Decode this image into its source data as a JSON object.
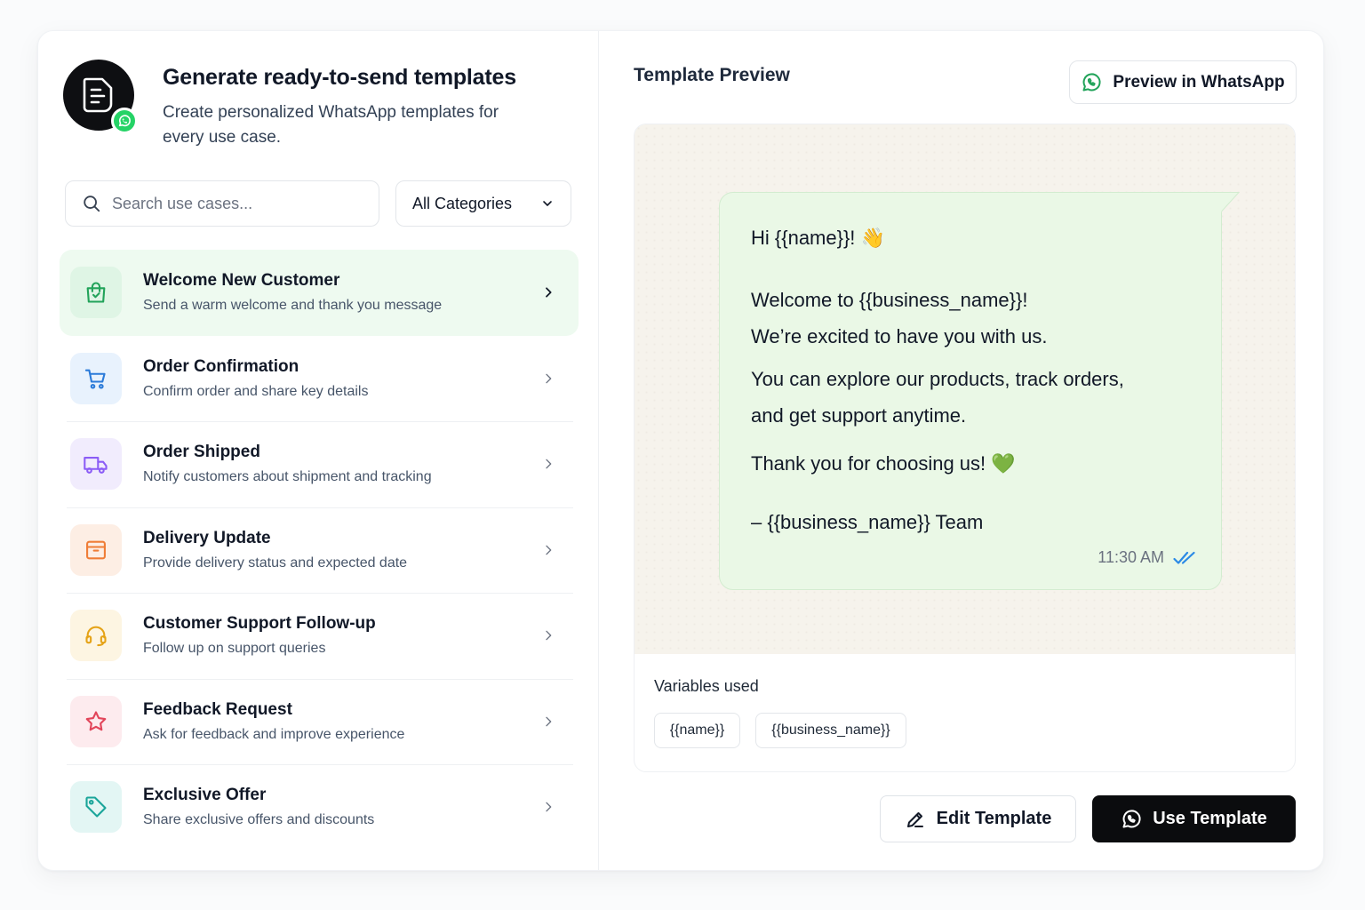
{
  "header": {
    "title": "Generate ready-to-send templates",
    "subtitle": "Create personalized WhatsApp templates for every use case."
  },
  "search": {
    "placeholder": "Search use cases..."
  },
  "category_select": {
    "selected": "All Categories"
  },
  "use_cases": [
    {
      "title": "Welcome New Customer",
      "desc": "Send a warm welcome and thank you message",
      "icon": "shopping-bag-icon",
      "color": "#22a35a",
      "bg": "#dff5e5",
      "active": true
    },
    {
      "title": "Order Confirmation",
      "desc": "Confirm order and share key details",
      "icon": "cart-icon",
      "color": "#2b7bd9",
      "bg": "#e8f2fd"
    },
    {
      "title": "Order Shipped",
      "desc": "Notify customers about shipment and tracking",
      "icon": "truck-icon",
      "color": "#8b5cf6",
      "bg": "#f1ecfd"
    },
    {
      "title": "Delivery Update",
      "desc": "Provide delivery status and expected date",
      "icon": "package-icon",
      "color": "#ef7d36",
      "bg": "#fdeee4"
    },
    {
      "title": "Customer Support Follow-up",
      "desc": "Follow up on support queries",
      "icon": "headset-icon",
      "color": "#e5a317",
      "bg": "#fdf5e2"
    },
    {
      "title": "Feedback Request",
      "desc": "Ask for feedback and improve experience",
      "icon": "star-icon",
      "color": "#e2455a",
      "bg": "#fdebee"
    },
    {
      "title": "Exclusive Offer",
      "desc": "Share exclusive offers and discounts",
      "icon": "tag-icon",
      "color": "#1aa59a",
      "bg": "#e3f6f4"
    }
  ],
  "preview": {
    "title": "Template Preview",
    "whatsapp_button": "Preview in WhatsApp",
    "message": {
      "greeting": "Hi {{name}}! 👋",
      "line1": "Welcome to {{business_name}}!",
      "line2": "We’re excited to have you with us.",
      "line3": "You can explore our products, track orders,",
      "line4": "and get support anytime.",
      "line5": "Thank you for choosing us! 💚",
      "signature": "– {{business_name}} Team",
      "time": "11:30 AM"
    },
    "variables_label": "Variables used",
    "variables": [
      "{{name}}",
      "{{business_name}}"
    ]
  },
  "actions": {
    "edit": "Edit Template",
    "use": "Use Template"
  },
  "colors": {
    "whatsapp_green": "#25d366",
    "active_bg": "#eefaf0",
    "read_tick": "#2b8ae6"
  }
}
